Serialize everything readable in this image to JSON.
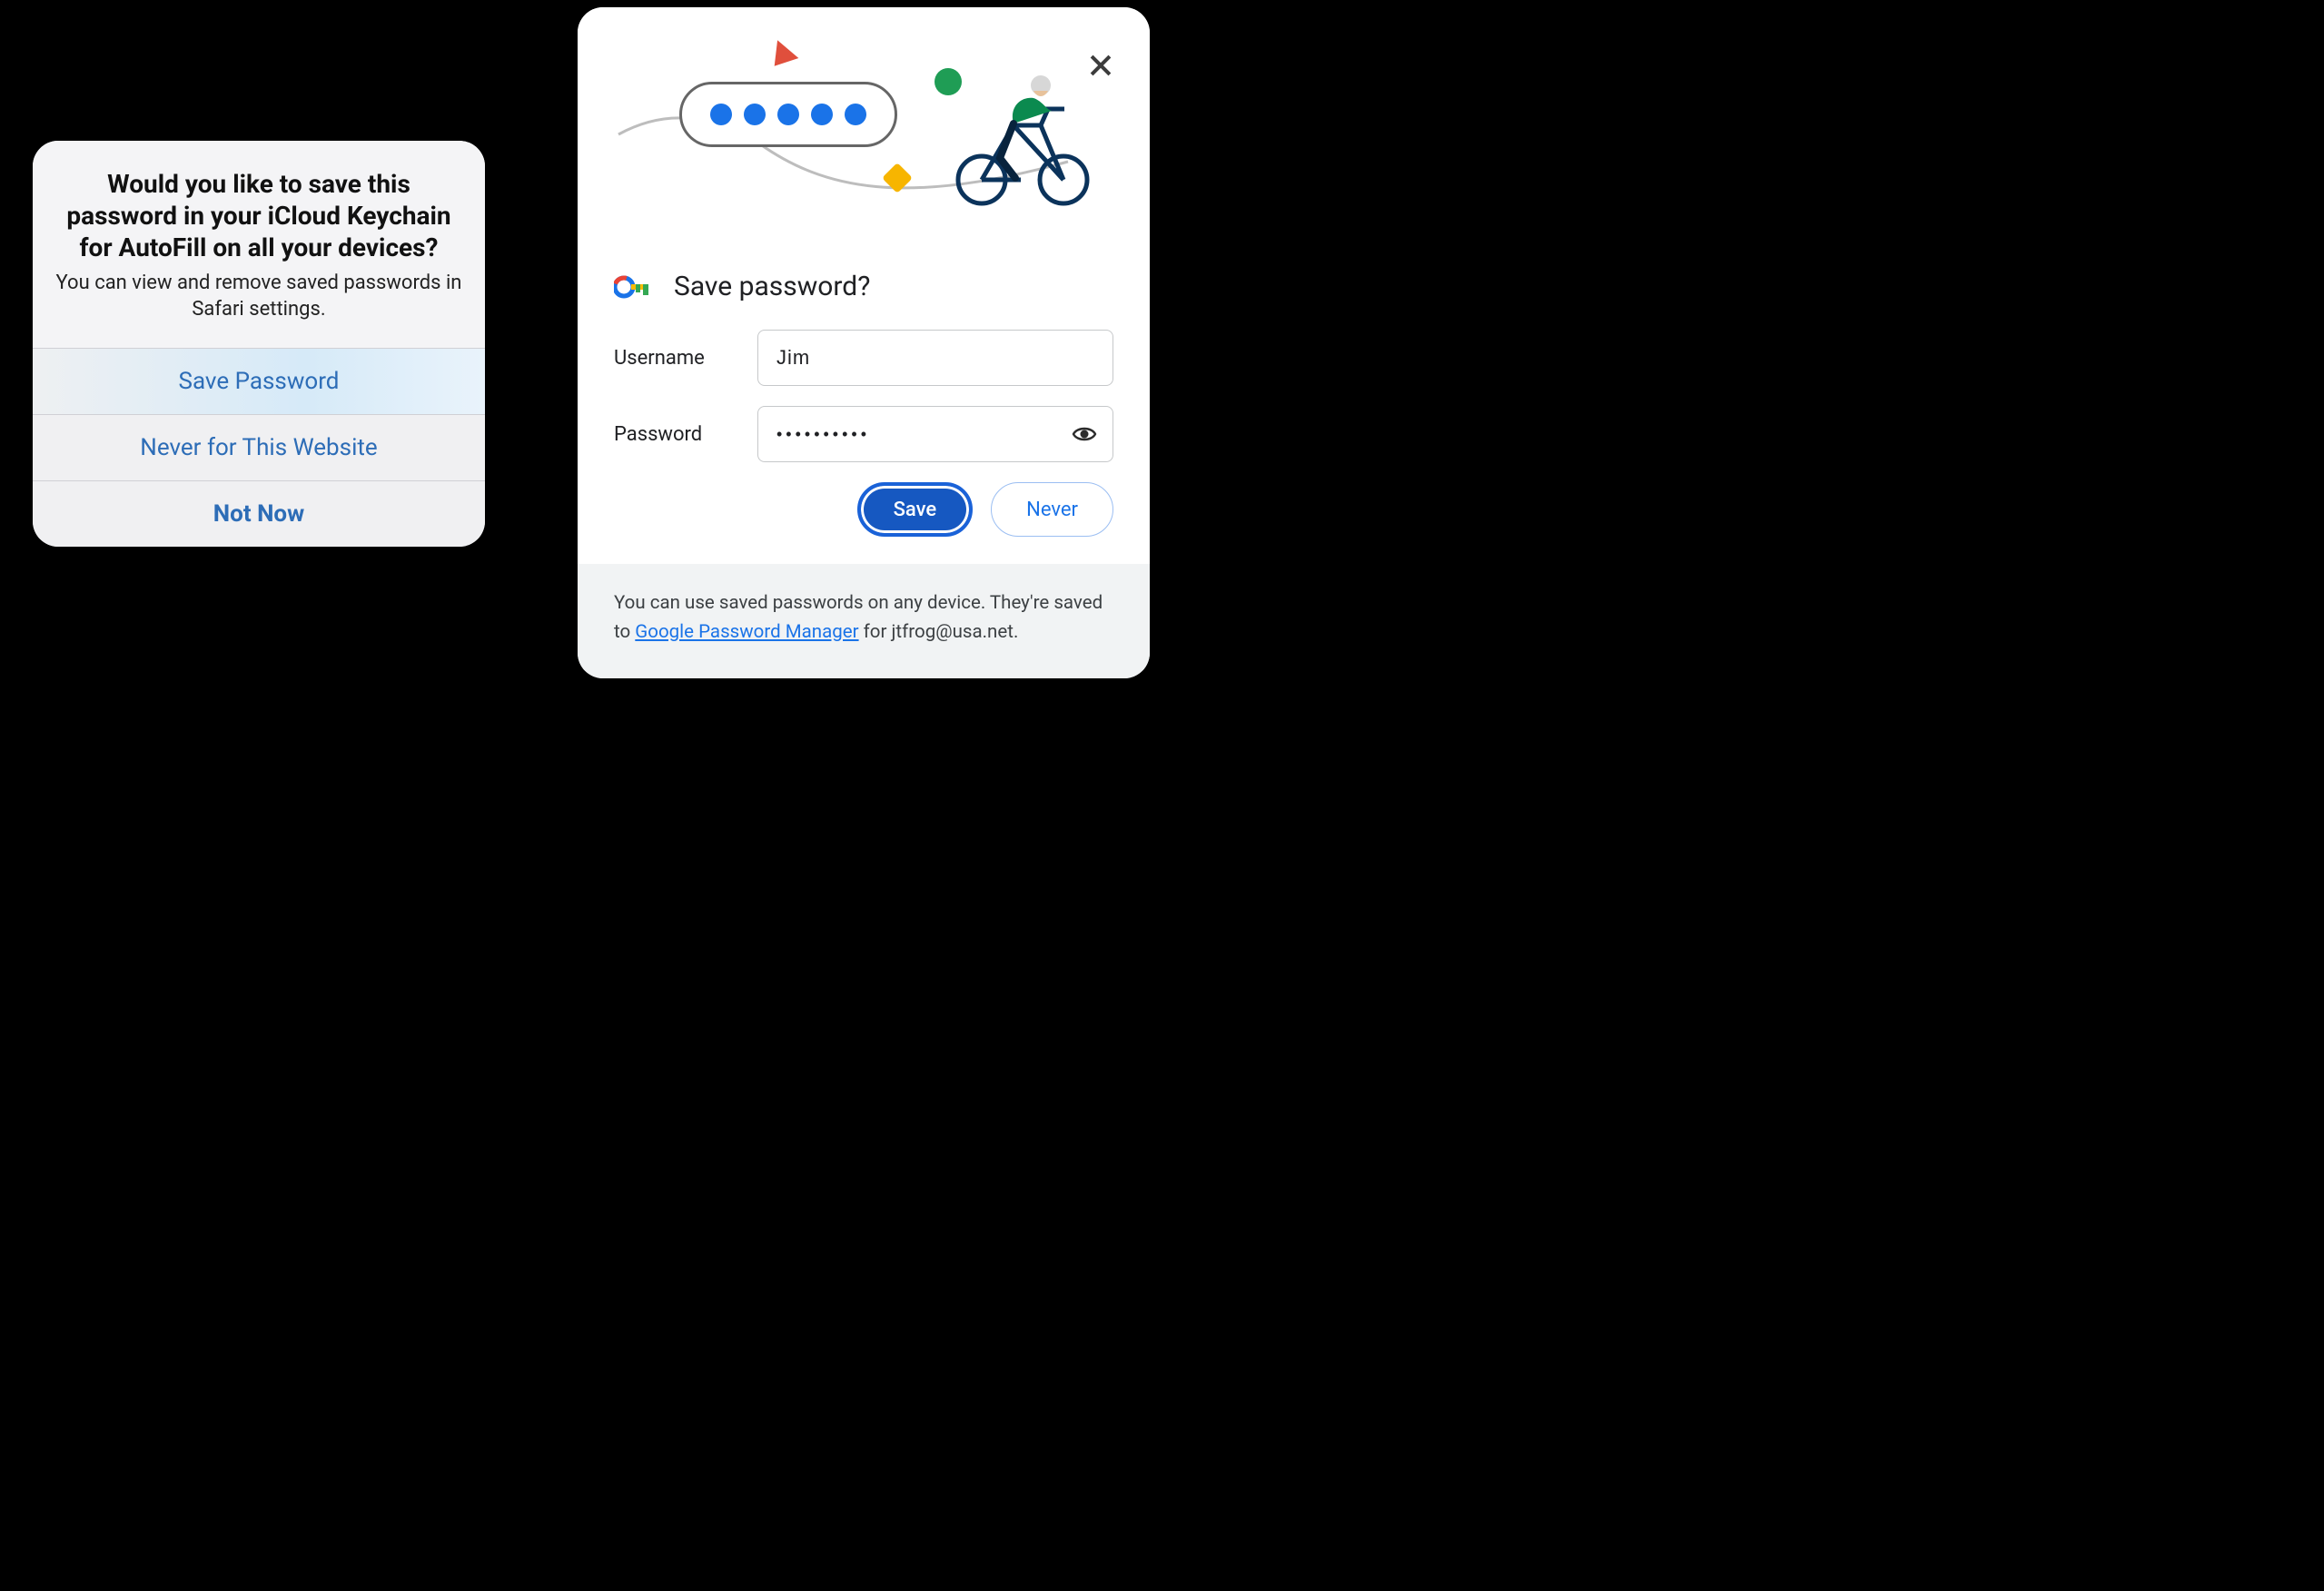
{
  "colors": {
    "ios_link": "#2d6db7",
    "chrome_primary": "#1a73e8",
    "chrome_primary_dark": "#1658c1"
  },
  "safari": {
    "title": "Would you like to save this password in your iCloud Keychain for AutoFill on all your devices?",
    "subtitle": "You can view and remove saved passwords in Safari settings.",
    "buttons": {
      "save": "Save Password",
      "never": "Never for This Website",
      "not_now": "Not Now"
    }
  },
  "chrome": {
    "close_icon": "close-icon",
    "key_icon": "key-icon",
    "illustration_icons": {
      "triangle": "red-triangle-icon",
      "circle": "green-circle-icon",
      "diamond": "yellow-diamond-icon",
      "pill": "password-pill-icon",
      "cyclist": "cyclist-illustration"
    },
    "heading": "Save password?",
    "fields": {
      "username_label": "Username",
      "username_value": "Jim",
      "password_label": "Password",
      "password_value": "••••••••••",
      "eye_icon": "show-password-icon"
    },
    "actions": {
      "save": "Save",
      "never": "Never"
    },
    "footer": {
      "text_before": "You can use saved passwords on any device. They're saved to ",
      "link_text": "Google Password Manager",
      "text_after": " for jtfrog@usa.net."
    }
  }
}
